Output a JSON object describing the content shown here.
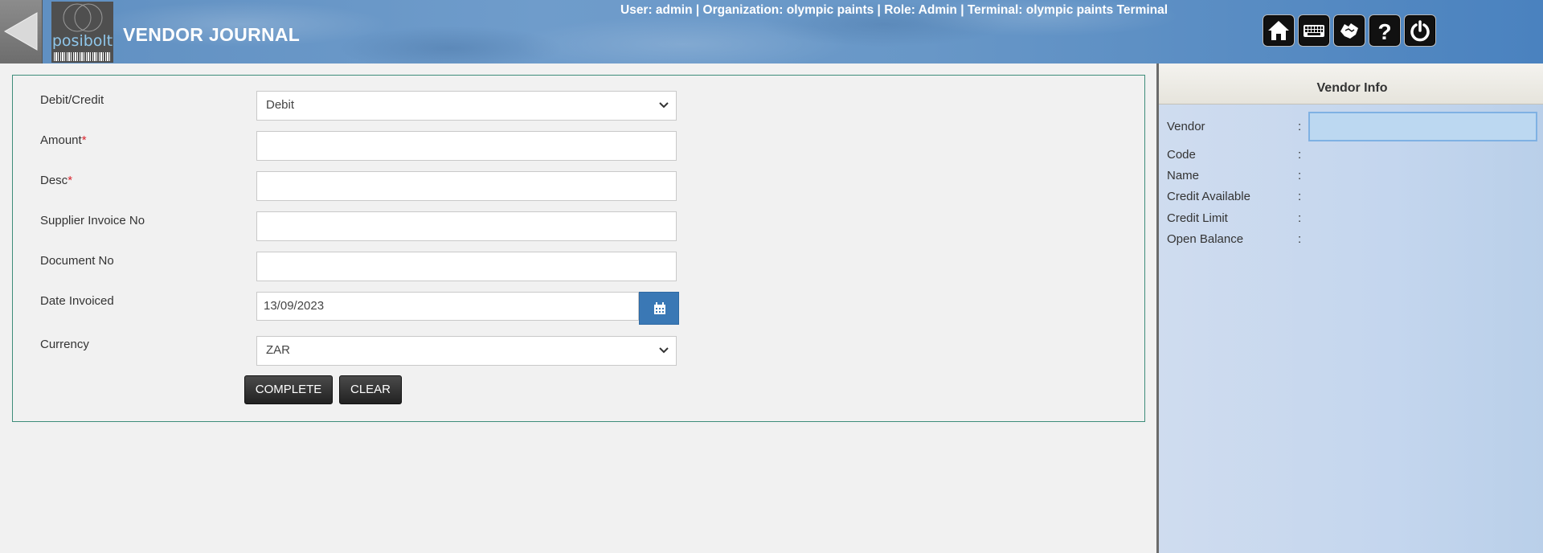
{
  "header": {
    "title": "VENDOR JOURNAL",
    "logo_text": "posibolt",
    "user_info": "User: admin | Organization: olympic paints | Role: Admin | Terminal: olympic paints Terminal",
    "icons": [
      "home-icon",
      "keyboard-icon",
      "hand-icon",
      "help-icon",
      "power-icon"
    ]
  },
  "form": {
    "debit_credit": {
      "label": "Debit/Credit",
      "value": "Debit"
    },
    "amount": {
      "label": "Amount",
      "required_mark": "*",
      "value": ""
    },
    "desc": {
      "label": "Desc",
      "required_mark": "*",
      "value": ""
    },
    "supplier_invoice_no": {
      "label": "Supplier Invoice No",
      "value": ""
    },
    "document_no": {
      "label": "Document No",
      "value": ""
    },
    "date_invoiced": {
      "label": "Date Invoiced",
      "value": "13/09/2023"
    },
    "currency": {
      "label": "Currency",
      "value": "ZAR"
    },
    "buttons": {
      "complete": "COMPLETE",
      "clear": "CLEAR"
    }
  },
  "vendor_info": {
    "title": "Vendor Info",
    "separator": ":",
    "fields": [
      {
        "label": "Vendor",
        "value": ""
      },
      {
        "label": "Code",
        "value": ""
      },
      {
        "label": "Name",
        "value": ""
      },
      {
        "label": "Credit Available",
        "value": ""
      },
      {
        "label": "Credit Limit",
        "value": ""
      },
      {
        "label": "Open Balance",
        "value": ""
      }
    ]
  },
  "colors": {
    "header_blue": "#6a98c8",
    "panel_border": "#3e8d7a",
    "calendar_button": "#3a78b5",
    "required": "#d9232d",
    "button_dark": "#2b2b2b"
  }
}
